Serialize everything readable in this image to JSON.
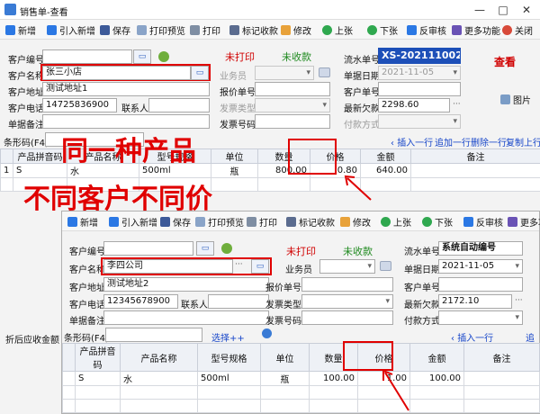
{
  "window": {
    "title": "销售单-查看"
  },
  "toolbar": {
    "items": [
      "新增",
      "引入新增",
      "保存",
      "打印预览",
      "打印",
      "标记收款",
      "修改",
      "上张",
      "下张",
      "反审核",
      "更多功能",
      "关闭"
    ]
  },
  "form1": {
    "customer_code_label": "客户编号",
    "customer_name_label": "客户名称",
    "customer_name": "张三小店",
    "customer_address_label": "客户地址",
    "customer_address": "测试地址1",
    "customer_phone_label": "客户电话",
    "customer_phone": "14725836900",
    "contact_label": "联系人",
    "remarks_label": "单据备注",
    "print_status": "未打印",
    "payment_status": "未收款",
    "salesperson_label": "业务员",
    "quote_no_label": "报价单号",
    "invoice_type_label": "发票类型",
    "invoice_no_label": "发票号码",
    "serial_no_label": "流水单号",
    "serial_no": "XS-202111002",
    "date_label": "单据日期",
    "date": "2021-11-05",
    "customer_no_label": "客户单号",
    "latest_debt_label": "最新欠款",
    "latest_debt": "2298.60",
    "payment_method_label": "付款方式",
    "view_mode": "查看",
    "image_label": "图片"
  },
  "grid1": {
    "barcode_label": "条形码(F4)",
    "actions": [
      "插入一行",
      "追加一行",
      "删除一行",
      "复制上行"
    ],
    "headers": [
      "产品拼音码",
      "产品名称",
      "型号规格",
      "单位",
      "数量",
      "价格",
      "金额",
      "备注"
    ],
    "row": {
      "no": "1",
      "code": "S",
      "name": "水",
      "spec": "500ml",
      "unit": "瓶",
      "qty": "800.00",
      "price": "0.80",
      "amount": "640.00"
    }
  },
  "overlay": {
    "line1": "同一种产品",
    "line2": "不同客户不同价"
  },
  "win2": {
    "toolbar_items": [
      "新增",
      "引入新增",
      "保存",
      "打印预览",
      "打印",
      "标记收款",
      "修改",
      "上张",
      "下张",
      "反审核",
      "更多功"
    ],
    "customer_code_label": "客户编号",
    "customer_name_label": "客户名称",
    "customer_name": "李四公司",
    "customer_address_label": "客户地址",
    "customer_address": "测试地址2",
    "customer_phone_label": "客户电话",
    "customer_phone": "12345678900",
    "contact_label": "联系人",
    "remarks_label": "单据备注",
    "print_status": "未打印",
    "payment_status": "未收款",
    "salesperson_label": "业务员",
    "quote_no_label": "报价单号",
    "invoice_type_label": "发票类型",
    "invoice_no_label": "发票号码",
    "serial_no_label": "流水单号",
    "serial_no": "系统自动编号",
    "date_label": "单据日期",
    "date": "2021-11-05",
    "customer_no_label": "客户单号",
    "latest_debt_label": "最新欠款",
    "latest_debt": "2172.10",
    "payment_method_label": "付款方式",
    "barcode_label": "条形码(F4)",
    "select_more": "选择++",
    "insert_row": "插入一行",
    "append_short": "追",
    "headers": [
      "产品拼音码",
      "产品名称",
      "型号规格",
      "单位",
      "数量",
      "价格",
      "金额",
      "备注"
    ],
    "row": {
      "code": "S",
      "name": "水",
      "spec": "500ml",
      "unit": "瓶",
      "qty": "100.00",
      "price": "1.00",
      "amount": "100.00"
    }
  },
  "bottom": {
    "left_text": "折后应收金额"
  },
  "colors": {
    "highlight": "#e00000",
    "link": "#1645c9",
    "serial_bg": "#1d4fb8"
  }
}
